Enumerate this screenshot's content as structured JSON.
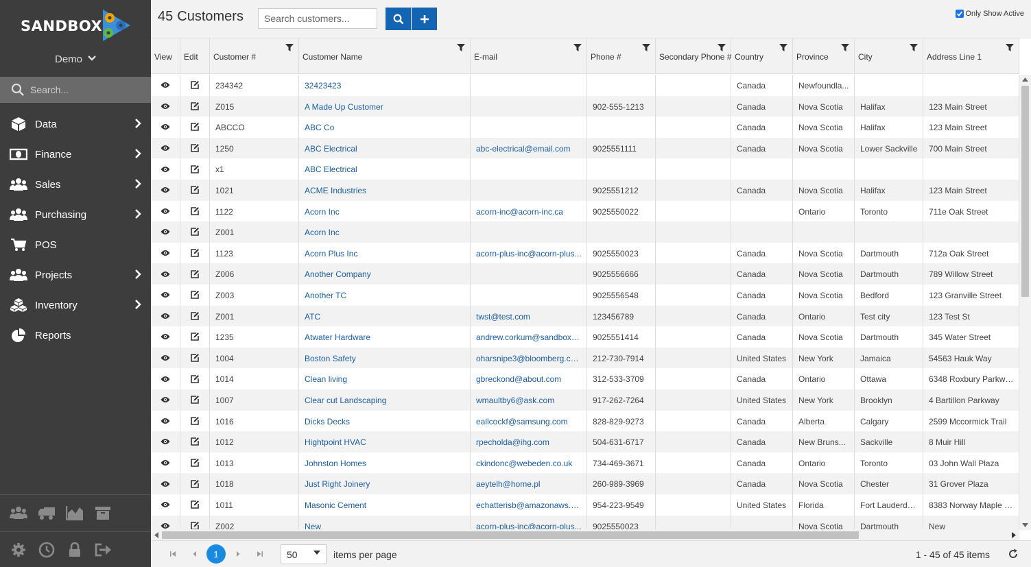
{
  "app": {
    "logo_text": "SANDBOX",
    "company": "Demo",
    "search_placeholder": "Search...",
    "accent": "#1464b4",
    "sidebar_bg": "#3d3d3d"
  },
  "nav": [
    {
      "label": "Data",
      "icon": "cube-icon",
      "arrow": true
    },
    {
      "label": "Finance",
      "icon": "money-icon",
      "arrow": true
    },
    {
      "label": "Sales",
      "icon": "users-icon",
      "arrow": true
    },
    {
      "label": "Purchasing",
      "icon": "users-icon",
      "arrow": true
    },
    {
      "label": "POS",
      "icon": "cart-icon",
      "arrow": false
    },
    {
      "label": "Projects",
      "icon": "users-icon",
      "arrow": true
    },
    {
      "label": "Inventory",
      "icon": "cubes-icon",
      "arrow": true
    },
    {
      "label": "Reports",
      "icon": "pie-chart-icon",
      "arrow": false
    }
  ],
  "bottom_icons_row1": [
    "users-icon",
    "truck-icon",
    "area-chart-icon",
    "archive-icon"
  ],
  "bottom_icons_row2": [
    "gear-icon",
    "clock-icon",
    "lock-icon",
    "sign-out-icon"
  ],
  "header": {
    "count": "45",
    "title": "Customers",
    "search_placeholder": "Search customers...",
    "only_active_label": "Only Show Active",
    "only_active_checked": true
  },
  "columns": [
    "View",
    "Edit",
    "Customer #",
    "Customer Name",
    "E-mail",
    "Phone #",
    "Secondary Phone #",
    "Country",
    "Province",
    "City",
    "Address Line 1"
  ],
  "rows": [
    {
      "num": "234342",
      "name": "32423423",
      "email": "",
      "phone": "",
      "phone2": "",
      "country": "Canada",
      "province": "Newfoundla...",
      "city": "",
      "addr": ""
    },
    {
      "num": "Z015",
      "name": "A Made Up Customer",
      "email": "",
      "phone": "902-555-1213",
      "phone2": "",
      "country": "Canada",
      "province": "Nova Scotia",
      "city": "Halifax",
      "addr": "123 Main Street"
    },
    {
      "num": "ABCCO",
      "name": "ABC Co",
      "email": "",
      "phone": "",
      "phone2": "",
      "country": "Canada",
      "province": "Nova Scotia",
      "city": "Halifax",
      "addr": "123 Main Street"
    },
    {
      "num": "1250",
      "name": "ABC Electrical",
      "email": "abc-electrical@email.com",
      "phone": "9025551111",
      "phone2": "",
      "country": "Canada",
      "province": "Nova Scotia",
      "city": "Lower Sackville",
      "addr": "700 Main Street"
    },
    {
      "num": "x1",
      "name": "ABC Electrical",
      "email": "",
      "phone": "",
      "phone2": "",
      "country": "",
      "province": "",
      "city": "",
      "addr": ""
    },
    {
      "num": "1021",
      "name": "ACME Industries",
      "email": "",
      "phone": "9025551212",
      "phone2": "",
      "country": "Canada",
      "province": "Nova Scotia",
      "city": "Halifax",
      "addr": "123 Main Street"
    },
    {
      "num": "1122",
      "name": "Acorn Inc",
      "email": "acorn-inc@acorn-inc.ca",
      "phone": "9025550022",
      "phone2": "",
      "country": "",
      "province": "Ontario",
      "city": "Toronto",
      "addr": "711e Oak Street"
    },
    {
      "num": "Z001",
      "name": "Acorn Inc",
      "email": "",
      "phone": "",
      "phone2": "",
      "country": "",
      "province": "",
      "city": "",
      "addr": ""
    },
    {
      "num": "1123",
      "name": "Acorn Plus Inc",
      "email": "acorn-plus-inc@acorn-plus...",
      "phone": "9025550023",
      "phone2": "",
      "country": "Canada",
      "province": "Nova Scotia",
      "city": "Dartmouth",
      "addr": "712a Oak Street"
    },
    {
      "num": "Z006",
      "name": "Another Company",
      "email": "",
      "phone": "9025556666",
      "phone2": "",
      "country": "Canada",
      "province": "Nova Scotia",
      "city": "Dartmouth",
      "addr": "789 Willow Street"
    },
    {
      "num": "Z003",
      "name": "Another TC",
      "email": "",
      "phone": "9025556548",
      "phone2": "",
      "country": "Canada",
      "province": "Nova Scotia",
      "city": "Bedford",
      "addr": "123 Granville Street"
    },
    {
      "num": "Z001",
      "name": "ATC",
      "email": "twst@test.com",
      "phone": "123456789",
      "phone2": "",
      "country": "Canada",
      "province": "Ontario",
      "city": "Test city",
      "addr": "123 Test St"
    },
    {
      "num": "1235",
      "name": "Atwater Hardware",
      "email": "andrew.corkum@sandboxo...",
      "phone": "9025551414",
      "phone2": "",
      "country": "Canada",
      "province": "Nova Scotia",
      "city": "Dartmouth",
      "addr": "345 Water Street"
    },
    {
      "num": "1004",
      "name": "Boston Safety",
      "email": "oharsnipe3@bloomberg.com",
      "phone": "212-730-7914",
      "phone2": "",
      "country": "United States",
      "province": "New York",
      "city": "Jamaica",
      "addr": "54563 Hauk Way"
    },
    {
      "num": "1014",
      "name": "Clean living",
      "email": "gbreckond@about.com",
      "phone": "312-533-3709",
      "phone2": "",
      "country": "Canada",
      "province": "Ontario",
      "city": "Ottawa",
      "addr": "6348 Roxbury Parkway"
    },
    {
      "num": "1007",
      "name": "Clear cut Landscaping",
      "email": "wmaultby6@ask.com",
      "phone": "917-262-7264",
      "phone2": "",
      "country": "United States",
      "province": "New York",
      "city": "Brooklyn",
      "addr": "4 Bartillon Parkway"
    },
    {
      "num": "1016",
      "name": "Dicks Decks",
      "email": "eallcockf@samsung.com",
      "phone": "828-829-9273",
      "phone2": "",
      "country": "Canada",
      "province": "Alberta",
      "city": "Calgary",
      "addr": "2599 Mccormick Trail"
    },
    {
      "num": "1012",
      "name": "Hightpoint HVAC",
      "email": "rpecholda@ihg.com",
      "phone": "504-631-6717",
      "phone2": "",
      "country": "Canada",
      "province": "New Bruns...",
      "city": "Sackville",
      "addr": "8 Muir Hill"
    },
    {
      "num": "1013",
      "name": "Johnston Homes",
      "email": "ckindonc@webeden.co.uk",
      "phone": "734-469-3671",
      "phone2": "",
      "country": "Canada",
      "province": "Ontario",
      "city": "Toronto",
      "addr": "03 John Wall Plaza"
    },
    {
      "num": "1018",
      "name": "Just Right Joinery",
      "email": "aeytelh@home.pl",
      "phone": "260-989-3969",
      "phone2": "",
      "country": "Canada",
      "province": "Nova Scotia",
      "city": "Chester",
      "addr": "31 Grover Plaza"
    },
    {
      "num": "1011",
      "name": "Masonic Cement",
      "email": "echatterisb@amazonaws.c...",
      "phone": "954-223-9549",
      "phone2": "",
      "country": "United States",
      "province": "Florida",
      "city": "Fort Lauderdale",
      "addr": "8383 Norway Maple La..."
    },
    {
      "num": "Z002",
      "name": "New",
      "email": "acorn-plus-inc@acorn-plus...",
      "phone": "9025550023",
      "phone2": "",
      "country": "",
      "province": "Nova Scotia",
      "city": "Dartmouth",
      "addr": "New"
    }
  ],
  "pager": {
    "current_page": "1",
    "page_size": "50",
    "items_label": "items per page",
    "info": "1 - 45 of 45 items"
  }
}
